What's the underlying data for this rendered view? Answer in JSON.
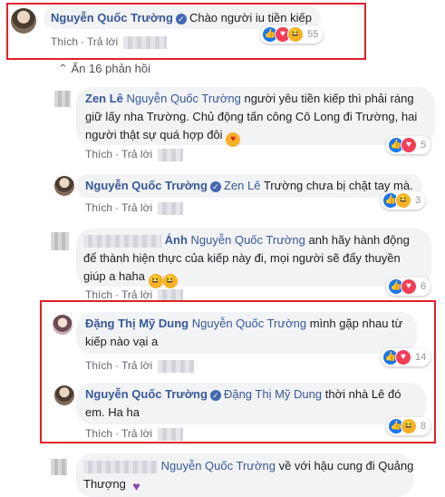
{
  "labels": {
    "like": "Thích",
    "reply": "Trả lời"
  },
  "hide_replies": "Ẩn 16 phản hồi",
  "comments": [
    {
      "name": "Nguyễn Quốc Trường",
      "text": "Chào người iu tiền kiếp",
      "reactions": "55"
    },
    {
      "name": "Zen Lê",
      "tag": "Nguyễn Quốc Trường",
      "text_line1": " người yêu tiền kiếp thì phải ráng",
      "text_line2": "giữ lấy nha Trường. Chủ động tấn công Cô Long đi Trường, hai",
      "text_line3": "người thật sự quá hợp đôi",
      "reactions": "5"
    },
    {
      "name": "Nguyễn Quốc Trường",
      "tag": "Zen Lê",
      "text": " Trường chưa bị chặt tay mà.",
      "reactions": "3"
    },
    {
      "name": "Ánh",
      "tag": "Nguyễn Quốc Trường",
      "text_line1": " anh hãy hành động",
      "text_line2": "để thành hiện thực của kiếp này đi, mọi người sẽ đẩy thuyền",
      "text_line3": "giúp a haha",
      "reactions": "6"
    },
    {
      "name": "Đặng Thị Mỹ Dung",
      "tag": "Nguyễn Quốc Trường",
      "text_line1": " mình gặp nhau từ",
      "text_line2": "kiếp nào vại a",
      "reactions": "14"
    },
    {
      "name": "Nguyễn Quốc Trường",
      "tag": "Đặng Thị Mỹ Dung",
      "text_line1": " thời nhà Lê đó",
      "text_line2": "em. Ha ha",
      "reactions": "8"
    },
    {
      "tag": "Nguyễn Quốc Trường",
      "text_line1": " về với hậu cung đi Quảng",
      "text_line2": "Thượng"
    }
  ],
  "colors": {
    "highlight_border": "#e0202a",
    "name": "#385898",
    "bubble": "#f2f3f5"
  }
}
